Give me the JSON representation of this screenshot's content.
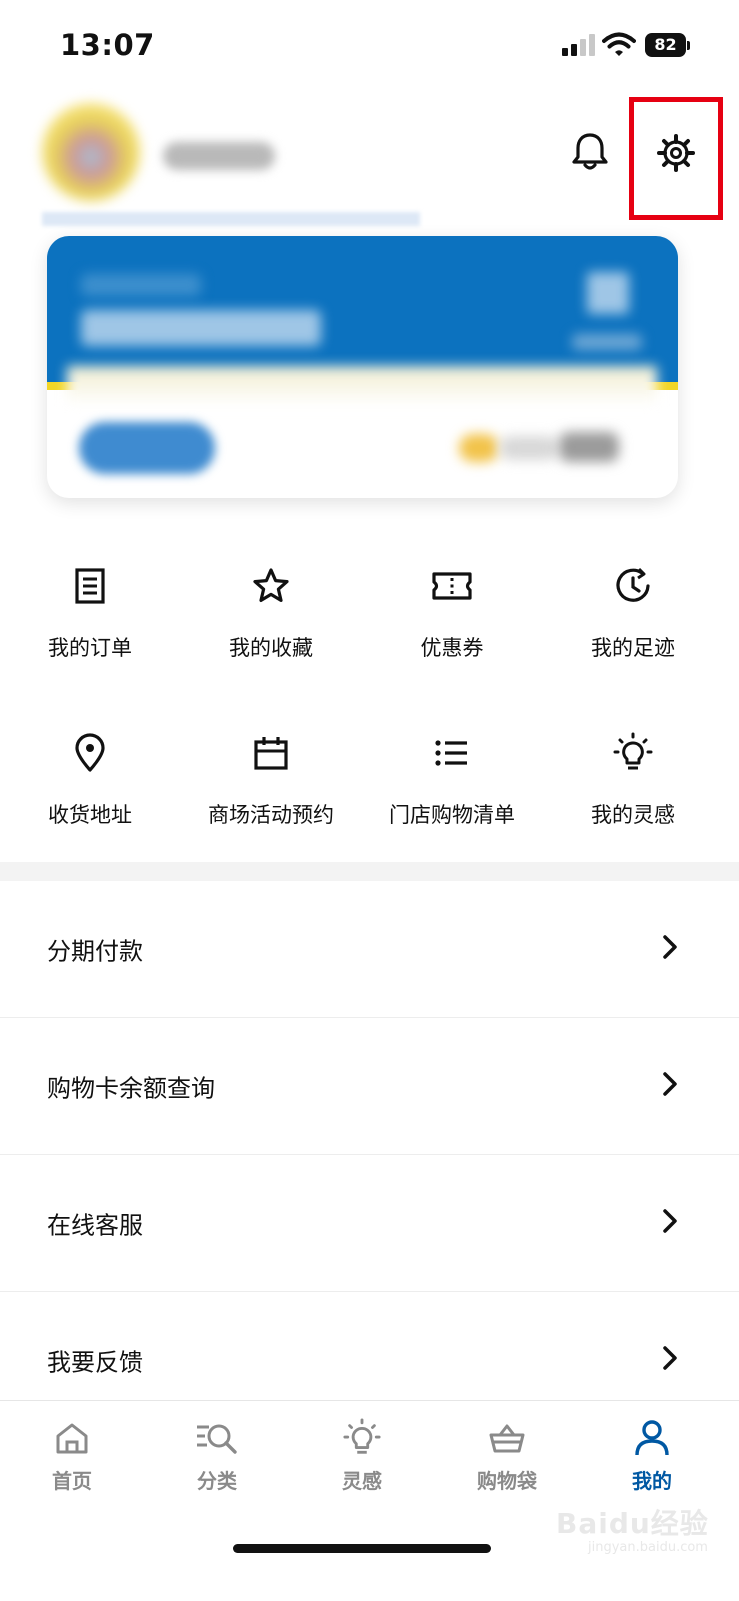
{
  "status_bar": {
    "time": "13:07",
    "battery": "82",
    "signal_icon": "signal-icon",
    "wifi_icon": "wifi-icon"
  },
  "header": {
    "notification_icon": "bell-icon",
    "settings_icon": "gear-icon",
    "highlight_color": "#e60012"
  },
  "membership_card": {
    "brand_blue": "#0c72bf",
    "brand_yellow": "#f3d626"
  },
  "shortcuts": [
    {
      "label": "我的订单",
      "icon": "order-list-icon"
    },
    {
      "label": "我的收藏",
      "icon": "star-icon"
    },
    {
      "label": "优惠券",
      "icon": "ticket-icon"
    },
    {
      "label": "我的足迹",
      "icon": "history-icon"
    },
    {
      "label": "收货地址",
      "icon": "location-pin-icon"
    },
    {
      "label": "商场活动预约",
      "icon": "calendar-icon"
    },
    {
      "label": "门店购物清单",
      "icon": "list-icon"
    },
    {
      "label": "我的灵感",
      "icon": "lightbulb-icon"
    }
  ],
  "menu": [
    {
      "label": "分期付款"
    },
    {
      "label": "购物卡余额查询"
    },
    {
      "label": "在线客服"
    },
    {
      "label": "我要反馈"
    }
  ],
  "tabbar": {
    "active_color": "#0058a3",
    "tabs": [
      {
        "label": "首页",
        "icon": "home-icon"
      },
      {
        "label": "分类",
        "icon": "category-search-icon"
      },
      {
        "label": "灵感",
        "icon": "lightbulb-icon"
      },
      {
        "label": "购物袋",
        "icon": "basket-icon"
      },
      {
        "label": "我的",
        "icon": "person-icon",
        "active": true
      }
    ]
  },
  "watermark": {
    "text": "Baidu经验",
    "sub": "jingyan.baidu.com"
  }
}
